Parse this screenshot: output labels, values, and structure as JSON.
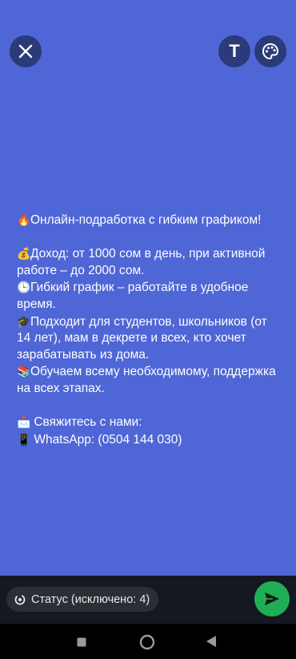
{
  "header": {
    "close_icon": "close-icon",
    "text_tool_label": "T",
    "palette_icon": "palette-icon"
  },
  "status": {
    "line1_emoji": "🔥",
    "line1": "Онлайн-подработка с гибким графиком!",
    "line2_emoji": "💰",
    "line2": "Доход: от 1000 сом в день, при активной",
    "line3": "работе – до 2000 сом.",
    "line4_emoji": "🕒",
    "line4": "Гибкий график – работайте в удобное",
    "line5": "время.",
    "line6_emoji": "🎓",
    "line6": "Подходит для студентов, школьников (от",
    "line7": "14 лет), мам в декрете и всех, кто хочет",
    "line8": "зарабатывать из дома.",
    "line9_emoji": "📚",
    "line9": "Обучаем всему необходимому, поддержка",
    "line10": "на всех этапах.",
    "line11_emoji": "📩",
    "line11": "Свяжитесь с нами:",
    "line12_emoji": "📱",
    "line12": "WhatsApp: (0504 144 030)"
  },
  "footer": {
    "audience_label": "Статус (исключено: 4)",
    "send_icon": "send-icon"
  },
  "colors": {
    "background": "#4f66d6",
    "round_button": "#2b3a78",
    "send_button": "#1fae55",
    "bottom_bar": "#141820"
  }
}
